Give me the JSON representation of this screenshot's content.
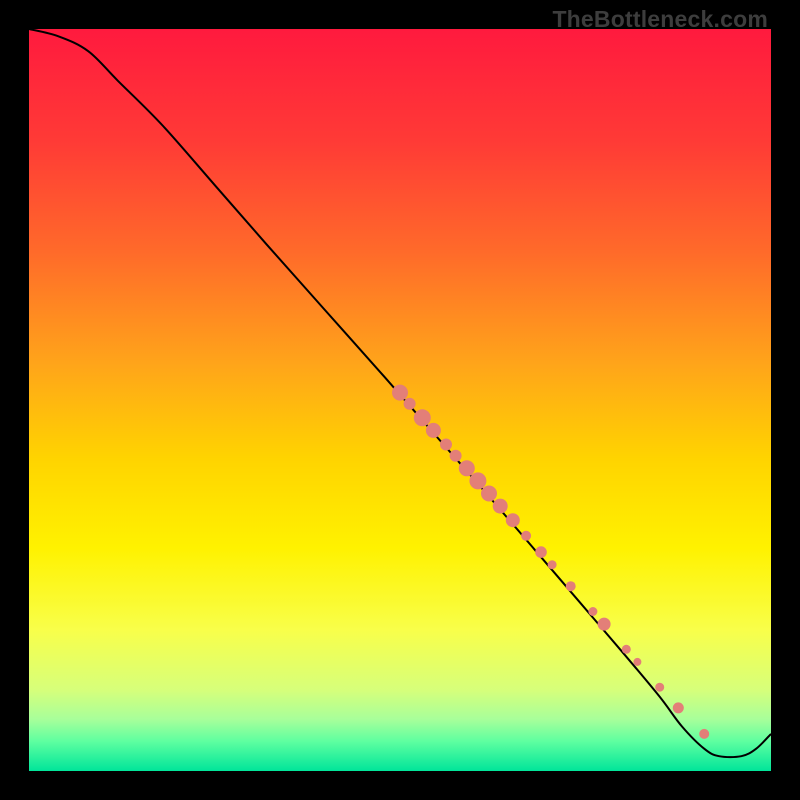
{
  "watermark": "TheBottleneck.com",
  "colors": {
    "point_fill": "#e37f78",
    "curve_stroke": "#000000",
    "gradient_stops": [
      {
        "offset": "0%",
        "color": "#ff1a3e"
      },
      {
        "offset": "15%",
        "color": "#ff3a36"
      },
      {
        "offset": "30%",
        "color": "#ff6a2a"
      },
      {
        "offset": "45%",
        "color": "#ffa41a"
      },
      {
        "offset": "58%",
        "color": "#ffd400"
      },
      {
        "offset": "70%",
        "color": "#fff200"
      },
      {
        "offset": "81%",
        "color": "#f8ff4a"
      },
      {
        "offset": "89%",
        "color": "#d7ff7a"
      },
      {
        "offset": "93%",
        "color": "#a8ff9a"
      },
      {
        "offset": "96%",
        "color": "#5effa0"
      },
      {
        "offset": "100%",
        "color": "#00e59a"
      }
    ]
  },
  "chart_data": {
    "type": "line",
    "title": "",
    "xlabel": "",
    "ylabel": "",
    "xlim": [
      0,
      100
    ],
    "ylim": [
      0,
      100
    ],
    "series": [
      {
        "name": "curve",
        "x": [
          0,
          4,
          8,
          12,
          18,
          25,
          32,
          40,
          48,
          55,
          62,
          68,
          74,
          80,
          85,
          88,
          91,
          93,
          96,
          98,
          100
        ],
        "y": [
          100,
          99,
          97,
          93,
          87,
          79,
          71,
          62,
          53,
          45,
          37,
          30,
          23,
          16,
          10,
          6,
          3,
          2,
          2,
          3,
          5
        ]
      }
    ],
    "points": [
      {
        "x": 50.0,
        "y": 51.0,
        "r": 8.0
      },
      {
        "x": 51.3,
        "y": 49.5,
        "r": 6.0
      },
      {
        "x": 53.0,
        "y": 47.6,
        "r": 8.5
      },
      {
        "x": 54.5,
        "y": 45.9,
        "r": 7.5
      },
      {
        "x": 56.2,
        "y": 44.0,
        "r": 6.0
      },
      {
        "x": 57.5,
        "y": 42.5,
        "r": 6.0
      },
      {
        "x": 59.0,
        "y": 40.8,
        "r": 8.0
      },
      {
        "x": 60.5,
        "y": 39.1,
        "r": 8.5
      },
      {
        "x": 62.0,
        "y": 37.4,
        "r": 8.0
      },
      {
        "x": 63.5,
        "y": 35.7,
        "r": 7.5
      },
      {
        "x": 65.2,
        "y": 33.8,
        "r": 7.0
      },
      {
        "x": 67.0,
        "y": 31.7,
        "r": 5.0
      },
      {
        "x": 69.0,
        "y": 29.5,
        "r": 5.8
      },
      {
        "x": 70.5,
        "y": 27.8,
        "r": 4.5
      },
      {
        "x": 73.0,
        "y": 24.9,
        "r": 5.0
      },
      {
        "x": 76.0,
        "y": 21.5,
        "r": 4.5
      },
      {
        "x": 77.5,
        "y": 19.8,
        "r": 6.5
      },
      {
        "x": 80.5,
        "y": 16.4,
        "r": 4.5
      },
      {
        "x": 82.0,
        "y": 14.7,
        "r": 4.0
      },
      {
        "x": 85.0,
        "y": 11.3,
        "r": 4.5
      },
      {
        "x": 87.5,
        "y": 8.5,
        "r": 5.5
      },
      {
        "x": 91.0,
        "y": 5.0,
        "r": 5.0
      }
    ]
  }
}
